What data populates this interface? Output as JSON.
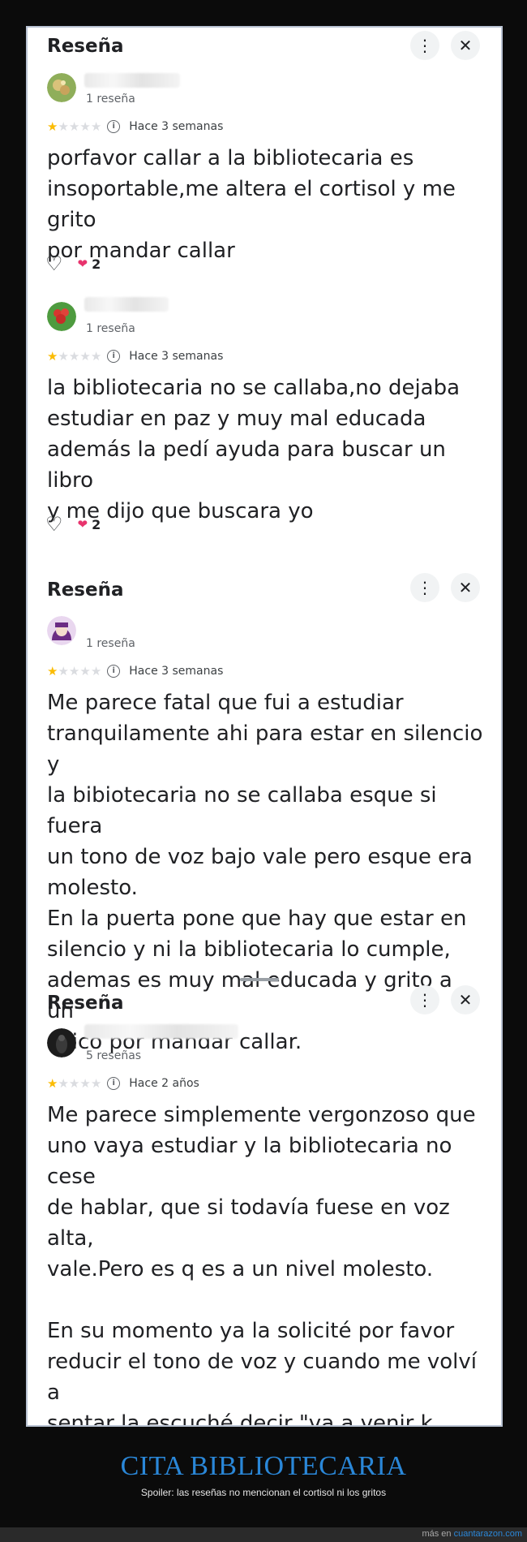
{
  "cards": [
    {
      "title": "Reseña",
      "reviews": [
        {
          "review_count": "1 reseña",
          "rating": 1,
          "time": "Hace 3 semanas",
          "text": "porfavor callar a la bibliotecaria es\ninsoportable,me altera el cortisol y me grito\npor mandar callar",
          "likes": "2"
        },
        {
          "review_count": "1 reseña",
          "rating": 1,
          "time": "Hace 3 semanas",
          "text": "la bibliotecaria no se callaba,no dejaba\nestudiar en paz y muy mal educada\nademás la pedí ayuda para buscar un libro\ny me dijo que buscara yo",
          "likes": "2"
        }
      ]
    },
    {
      "title": "Reseña",
      "reviews": [
        {
          "review_count": "1 reseña",
          "rating": 1,
          "time": "Hace 3 semanas",
          "text": "Me parece fatal que fui a estudiar\ntranquilamente ahi para estar en silencio y\nla bibiotecaria no se callaba esque si fuera\nun tono de voz bajo vale pero esque era\nmolesto.\nEn la puerta pone que hay que estar en\nsilencio y ni la bibliotecaria lo cumple,\nademas es muy mal educada y grito a un\nchico por mandar callar."
        }
      ]
    },
    {
      "title": "Reseña",
      "reviews": [
        {
          "review_count": "5 reseñas",
          "rating": 1,
          "time": "Hace 2 años",
          "text": "Me parece simplemente vergonzoso que\nuno vaya  estudiar y la bibliotecaria no cese\nde hablar, que si todavía fuese en voz alta,\nvale.Pero es q es a un nivel molesto.\n\nEn su momento ya la solicité por favor\nreducir el tono de voz y cuando me volví a\nsentar la escuché decir \"va a venir k niñata\nestá a mandarme callar\". Simplemente\npatético y nada profesional."
        }
      ]
    }
  ],
  "icons": {
    "more": "more-vert-icon",
    "close": "close-icon",
    "info": "info-icon",
    "like": "heart-outline-icon",
    "reaction": "heart-filled-icon",
    "star": "star-icon"
  },
  "colors": {
    "star_filled": "#fbbc04",
    "star_empty": "#dadce0",
    "heart": "#e8336d",
    "footer_title": "#2a87d8"
  },
  "footer": {
    "title": "CITA BIBLIOTECARIA",
    "subtitle": "Spoiler: las reseñas no mencionan el cortisol ni los gritos",
    "credit_prefix": "más en",
    "credit_site": "cuantarazon.com"
  }
}
